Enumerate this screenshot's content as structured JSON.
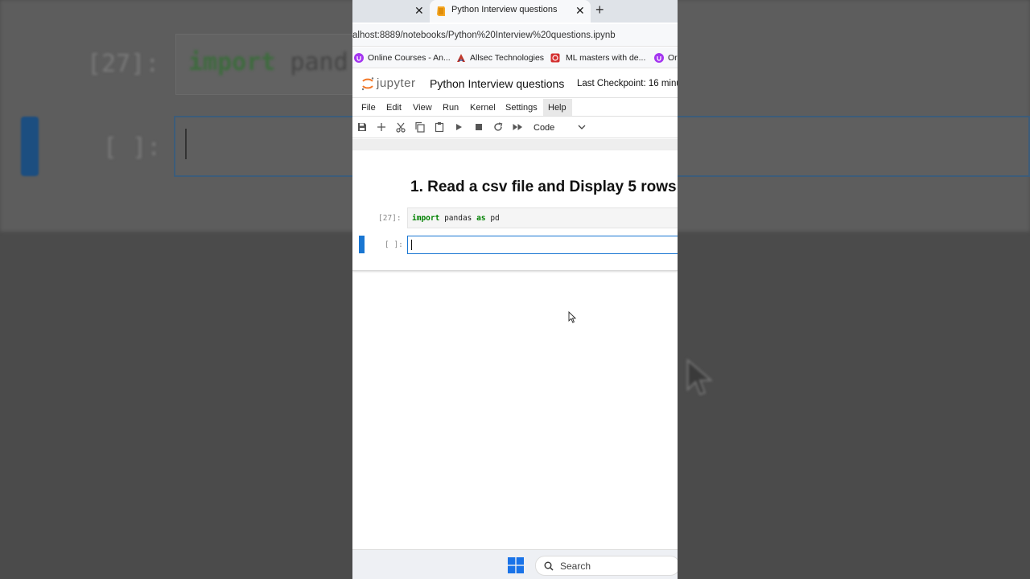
{
  "background_zoom": {
    "prompt_executed": "[27]:",
    "code_keyword": "import",
    "code_rest": "pand",
    "prompt_empty": "[ ]:"
  },
  "browser": {
    "tabs": [
      {
        "title": "Python Interview questions",
        "active": true
      }
    ],
    "new_tab_symbol": "+",
    "close_symbol": "✕",
    "address": "alhost:8889/notebooks/Python%20Interview%20questions.ipynb",
    "bookmarks": [
      {
        "label": "Online Courses - An...",
        "icon": "udemy-icon",
        "color": "#a435f0"
      },
      {
        "label": "Allsec Technologies",
        "icon": "allsec-icon",
        "color": "#c0392b"
      },
      {
        "label": "ML masters with de...",
        "icon": "ml-masters-icon",
        "color": "#d32f2f"
      },
      {
        "label": "Or",
        "icon": "udemy-icon",
        "color": "#a435f0"
      }
    ]
  },
  "jupyter": {
    "logo_text": "jupyter",
    "notebook_title": "Python Interview questions",
    "checkpoint": "Last Checkpoint: 16 minu",
    "menu": [
      "File",
      "Edit",
      "View",
      "Run",
      "Kernel",
      "Settings",
      "Help"
    ],
    "cell_type": "Code",
    "accent": "#1976d2",
    "logo_color": "#f37726"
  },
  "notebook": {
    "heading": "1. Read a csv file and Display 5 rows",
    "cell1": {
      "prompt": "[27]:",
      "code_keyword1": "import",
      "code_name": "pandas",
      "code_keyword2": "as",
      "code_alias": "pd"
    },
    "cell2": {
      "prompt": "[ ]:"
    }
  },
  "taskbar": {
    "search_label": "Search",
    "windows_color": "#1a73e8"
  }
}
